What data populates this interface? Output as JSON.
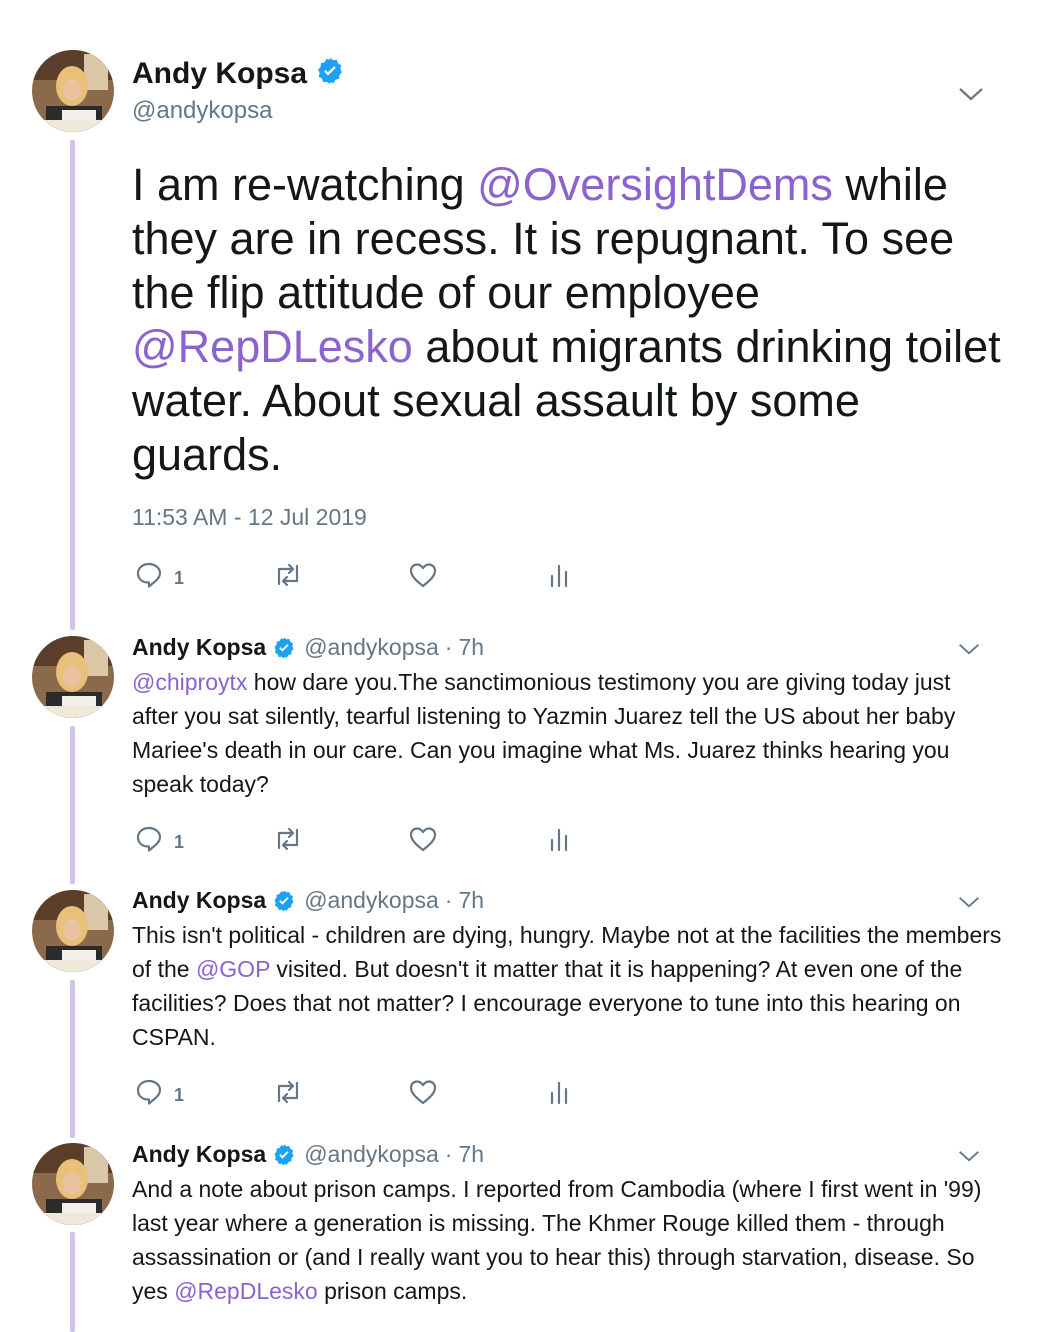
{
  "main_tweet": {
    "name": "Andy Kopsa",
    "handle": "@andykopsa",
    "text_parts": {
      "p1": "I am re-watching ",
      "m1": "@OversightDems",
      "p2": " while they are in recess. It is repugnant. To see the flip attitude of our employee ",
      "m2": "@RepDLesko",
      "p3": " about migrants drinking toilet water. About sexual assault by some guards."
    },
    "timestamp": "11:53 AM - 12 Jul 2019",
    "reply_count": "1"
  },
  "replies": [
    {
      "name": "Andy Kopsa",
      "handle": "@andykopsa",
      "sep": "·",
      "time": "7h",
      "m1": "@chiproytx",
      "p1": " how dare you.The sanctimonious testimony you are giving today just after you sat silently, tearful listening to Yazmin Juarez tell the US about her baby Mariee's death in our care. Can you imagine what Ms. Juarez thinks hearing you speak today?",
      "reply_count": "1"
    },
    {
      "name": "Andy Kopsa",
      "handle": "@andykopsa",
      "sep": "·",
      "time": "7h",
      "p1": "This isn't political - children are dying, hungry. Maybe not at the facilities the members of the ",
      "m1": "@GOP",
      "p2": " visited. But doesn't it matter that it is happening? At even one of the facilities?  Does that not matter? I encourage everyone to tune into this hearing on CSPAN.",
      "reply_count": "1"
    },
    {
      "name": "Andy Kopsa",
      "handle": "@andykopsa",
      "sep": "·",
      "time": "7h",
      "p1": "And a note about prison camps. I reported from Cambodia (where I first went in '99) last year where a generation  is missing. The Khmer Rouge killed them - through assassination or (and I really want you to hear this) through starvation, disease. So yes ",
      "m1": "@RepDLesko",
      "p2": " prison camps."
    }
  ],
  "icons": {
    "verified": "verified-badge-icon",
    "reply": "reply-icon",
    "retweet": "retweet-icon",
    "like": "like-icon",
    "analytics": "analytics-icon",
    "caret": "chevron-down-icon"
  },
  "colors": {
    "mention": "#8a63cf",
    "thread_line": "#d3c2ea",
    "verified": "#1da1f2",
    "muted": "#657786"
  }
}
